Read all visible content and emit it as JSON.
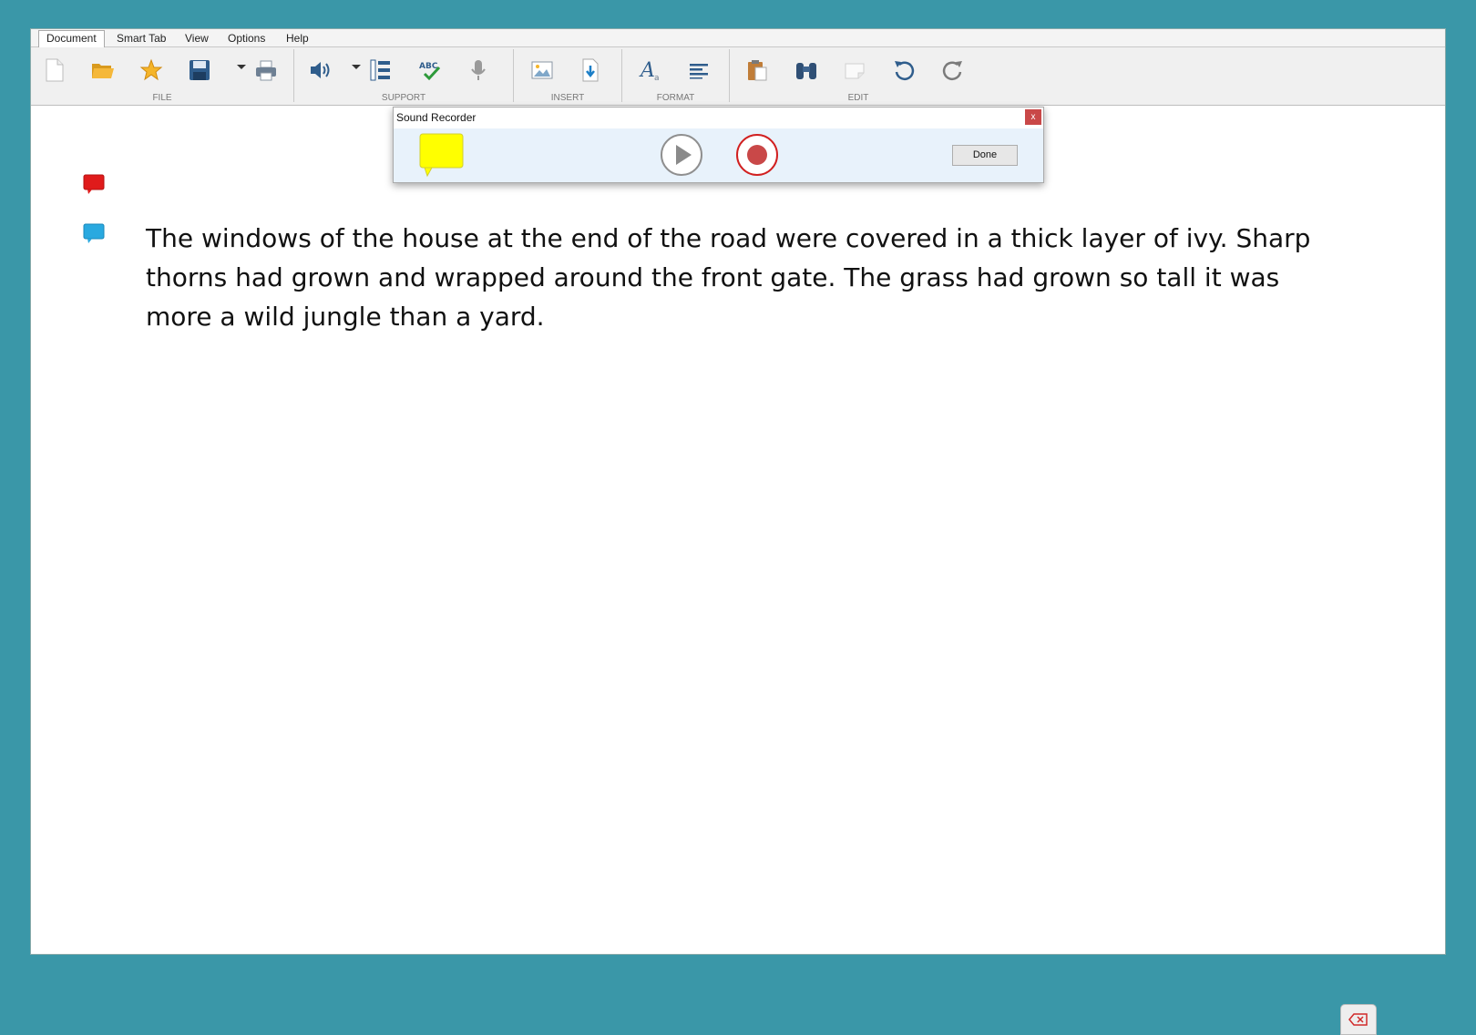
{
  "menu": {
    "items": [
      {
        "label": "Document",
        "active": true
      },
      {
        "label": "Smart Tab"
      },
      {
        "label": "View"
      },
      {
        "label": "Options"
      },
      {
        "label": "Help"
      }
    ]
  },
  "ribbon": {
    "groups": {
      "file": "FILE",
      "support": "SUPPORT",
      "insert": "INSERT",
      "format": "FORMAT",
      "edit": "EDIT"
    }
  },
  "recorder": {
    "title": "Sound Recorder",
    "close_label": "x",
    "done_label": "Done"
  },
  "document": {
    "paragraph": "The windows of the house at the end of the road were covered in a thick layer of ivy. Sharp thorns had grown and wrapped around the front gate. The grass had grown so tall it was more a wild jungle than a yard."
  },
  "colors": {
    "background": "#3a97a8",
    "comment_red": "#e01b1b",
    "comment_blue": "#29a9e0",
    "sticky_yellow": "#ffff00",
    "record_red": "#c94848"
  }
}
